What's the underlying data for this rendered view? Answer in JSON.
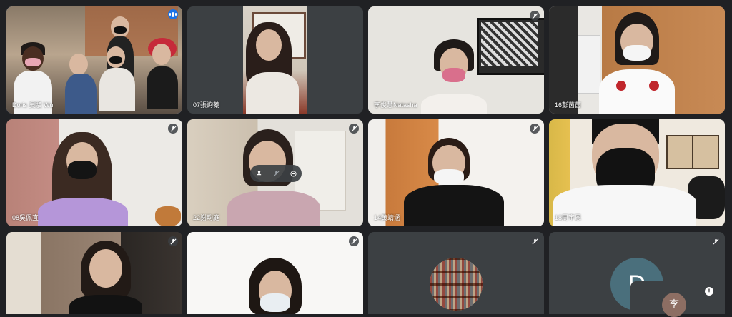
{
  "tiles": [
    {
      "name": "Doris 吳駁 Wu"
    },
    {
      "name": "07張詢蓁"
    },
    {
      "name": "李俊慧Natasha"
    },
    {
      "name": "16彭茵茵"
    },
    {
      "name": "08吳佩宜"
    },
    {
      "name": "22謝昀庭"
    },
    {
      "name": "14黃靖涵"
    },
    {
      "name": "18周宇恩"
    },
    {
      "name": ""
    },
    {
      "name": ""
    },
    {
      "name": ""
    },
    {
      "name": ""
    }
  ],
  "participant_avatar_letter": "D",
  "self_view_initial": "李",
  "self_view_alert": "!"
}
